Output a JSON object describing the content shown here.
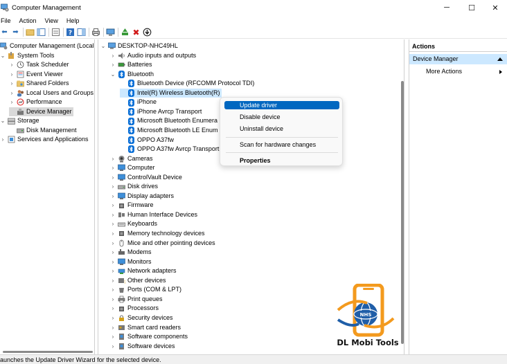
{
  "window": {
    "title": "Computer Management",
    "minimize": "─",
    "maximize": "☐",
    "close": "✕"
  },
  "menu": [
    "File",
    "Action",
    "View",
    "Help"
  ],
  "left_tree": [
    {
      "label": "Computer Management (Local",
      "level": 0,
      "chev": ""
    },
    {
      "label": "System Tools",
      "level": 1,
      "chev": "⌄"
    },
    {
      "label": "Task Scheduler",
      "level": 2,
      "chev": "›"
    },
    {
      "label": "Event Viewer",
      "level": 2,
      "chev": "›"
    },
    {
      "label": "Shared Folders",
      "level": 2,
      "chev": "›"
    },
    {
      "label": "Local Users and Groups",
      "level": 2,
      "chev": "›"
    },
    {
      "label": "Performance",
      "level": 2,
      "chev": "›"
    },
    {
      "label": "Device Manager",
      "level": 2,
      "chev": "",
      "selected": true
    },
    {
      "label": "Storage",
      "level": 1,
      "chev": "⌄"
    },
    {
      "label": "Disk Management",
      "level": 2,
      "chev": ""
    },
    {
      "label": "Services and Applications",
      "level": 1,
      "chev": "›"
    }
  ],
  "device_tree": [
    {
      "label": "DESKTOP-NHC49HL",
      "level": 0,
      "chev": "⌄",
      "icon": "computer"
    },
    {
      "label": "Audio inputs and outputs",
      "level": 1,
      "chev": "›",
      "icon": "audio"
    },
    {
      "label": "Batteries",
      "level": 1,
      "chev": "›",
      "icon": "battery"
    },
    {
      "label": "Bluetooth",
      "level": 1,
      "chev": "⌄",
      "icon": "bt"
    },
    {
      "label": "Bluetooth Device (RFCOMM Protocol TDI)",
      "level": 2,
      "chev": "",
      "icon": "bt"
    },
    {
      "label": "Intel(R) Wireless Bluetooth(R)",
      "level": 2,
      "chev": "",
      "icon": "bt",
      "highlight": true
    },
    {
      "label": "iPhone",
      "level": 2,
      "chev": "",
      "icon": "bt"
    },
    {
      "label": "iPhone Avrcp Transport",
      "level": 2,
      "chev": "",
      "icon": "bt"
    },
    {
      "label": "Microsoft Bluetooth Enumera",
      "level": 2,
      "chev": "",
      "icon": "bt"
    },
    {
      "label": "Microsoft Bluetooth LE Enum",
      "level": 2,
      "chev": "",
      "icon": "bt"
    },
    {
      "label": "OPPO A37fw",
      "level": 2,
      "chev": "",
      "icon": "bt"
    },
    {
      "label": "OPPO A37fw Avrcp Transport",
      "level": 2,
      "chev": "",
      "icon": "bt"
    },
    {
      "label": "Cameras",
      "level": 1,
      "chev": "›",
      "icon": "camera"
    },
    {
      "label": "Computer",
      "level": 1,
      "chev": "›",
      "icon": "monitor"
    },
    {
      "label": "ControlVault Device",
      "level": 1,
      "chev": "›",
      "icon": "monitor"
    },
    {
      "label": "Disk drives",
      "level": 1,
      "chev": "›",
      "icon": "disk"
    },
    {
      "label": "Display adapters",
      "level": 1,
      "chev": "›",
      "icon": "monitor"
    },
    {
      "label": "Firmware",
      "level": 1,
      "chev": "›",
      "icon": "chip"
    },
    {
      "label": "Human Interface Devices",
      "level": 1,
      "chev": "›",
      "icon": "hid"
    },
    {
      "label": "Keyboards",
      "level": 1,
      "chev": "›",
      "icon": "keyboard"
    },
    {
      "label": "Memory technology devices",
      "level": 1,
      "chev": "›",
      "icon": "chip"
    },
    {
      "label": "Mice and other pointing devices",
      "level": 1,
      "chev": "›",
      "icon": "mouse"
    },
    {
      "label": "Modems",
      "level": 1,
      "chev": "›",
      "icon": "modem"
    },
    {
      "label": "Monitors",
      "level": 1,
      "chev": "›",
      "icon": "monitor"
    },
    {
      "label": "Network adapters",
      "level": 1,
      "chev": "›",
      "icon": "network"
    },
    {
      "label": "Other devices",
      "level": 1,
      "chev": "›",
      "icon": "other"
    },
    {
      "label": "Ports (COM & LPT)",
      "level": 1,
      "chev": "›",
      "icon": "port"
    },
    {
      "label": "Print queues",
      "level": 1,
      "chev": "›",
      "icon": "printer"
    },
    {
      "label": "Processors",
      "level": 1,
      "chev": "›",
      "icon": "chip"
    },
    {
      "label": "Security devices",
      "level": 1,
      "chev": "›",
      "icon": "security"
    },
    {
      "label": "Smart card readers",
      "level": 1,
      "chev": "›",
      "icon": "smartcard"
    },
    {
      "label": "Software components",
      "level": 1,
      "chev": "›",
      "icon": "software"
    },
    {
      "label": "Software devices",
      "level": 1,
      "chev": "›",
      "icon": "software"
    }
  ],
  "context_menu": [
    {
      "label": "Update driver",
      "active": true
    },
    {
      "label": "Disable device"
    },
    {
      "label": "Uninstall device"
    },
    {
      "sep": true
    },
    {
      "label": "Scan for hardware changes"
    },
    {
      "sep": true
    },
    {
      "label": "Properties",
      "bold": true
    }
  ],
  "actions": {
    "header": "Actions",
    "item": "Device Manager",
    "more": "More Actions"
  },
  "status": "aunches the Update Driver Wizard for the selected device.",
  "watermark": {
    "text": "DL Mobi Tools",
    "badge": "NHS"
  },
  "colors": {
    "accent": "#0067c0",
    "selection": "#cce8ff",
    "bluetooth": "#0a6fd6",
    "watermark_orange": "#f39a1e",
    "watermark_blue": "#1f5ea8"
  }
}
